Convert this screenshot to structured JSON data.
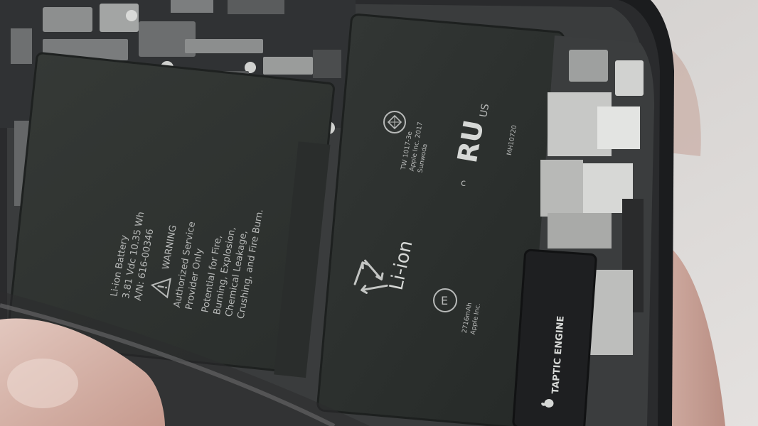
{
  "colors": {
    "background": "#d9d6d4",
    "frame": "#1b1c1e",
    "battery_cell": "#2f3331",
    "battery_print": "#b7b9b8",
    "board": "#3a3b3c",
    "skin": "#c9a59b",
    "taptic": "#1e1f21"
  },
  "left_cell_print": {
    "line_1": "Li-ion Battery",
    "line_2": "3.81 Vdc  10.35 Wh",
    "line_3": "A/N: 616-00346",
    "warning_title": "WARNING",
    "warning_lines": [
      "Authorized Service",
      "Provider Only",
      "Potential for Fire,",
      "Burning, Explosion,",
      "Chemical Leakage,",
      "Crushing, and Fire Burn."
    ]
  },
  "right_cell_print": {
    "cert_lines": [
      "TW 1017-3e",
      "Apple Inc. 2017",
      "Sunwoda"
    ],
    "ul_mark": "US",
    "ul_c": "c",
    "ul_number": "MH10720",
    "chemistry": "Li-ion",
    "capacity_lines": [
      "2716mAh",
      "Apple Inc."
    ]
  },
  "taptic_label": "TAPTIC ENGINE",
  "icons": {
    "warning": "warning-triangle-icon",
    "recycle": "recycle-icon",
    "certification": "certification-mark-icon",
    "ul": "ul-mark-icon",
    "battery_disposal": "battery-disposal-icon",
    "apple": "apple-logo-icon"
  }
}
